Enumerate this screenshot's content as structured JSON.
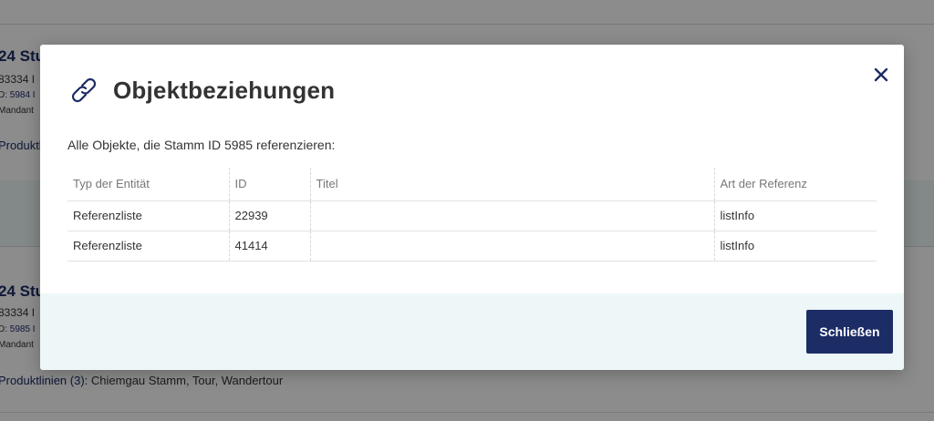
{
  "background": {
    "entries": [
      {
        "title": "24 Stu",
        "subtitle": "83334 I",
        "id_prefix": "D:",
        "id_value": "5984 I",
        "mandant": "Mandant",
        "produktlinien": "Produktl"
      },
      {
        "title": "24 Stu",
        "subtitle": "83334 I",
        "id_prefix": "D:",
        "id_value": "5985 I",
        "mandant": "Mandant",
        "produktlinien_label": "Produktlinien (3):",
        "produktlinien_values": "Chiemgau Stamm, Tour, Wandertour"
      }
    ]
  },
  "modal": {
    "title": "Objektbeziehungen",
    "description": "Alle Objekte, die Stamm ID 5985 referenzieren:",
    "table": {
      "headers": [
        "Typ der Entität",
        "ID",
        "Titel",
        "Art der Referenz"
      ],
      "rows": [
        [
          "Referenzliste",
          "22939",
          "",
          "listInfo"
        ],
        [
          "Referenzliste",
          "41414",
          "",
          "listInfo"
        ]
      ]
    },
    "close_button": "Schließen",
    "close_icon": "close-icon",
    "header_icon": "link-icon"
  },
  "colors": {
    "accent": "#1c2d66",
    "footer_bg": "#eef7f8"
  }
}
